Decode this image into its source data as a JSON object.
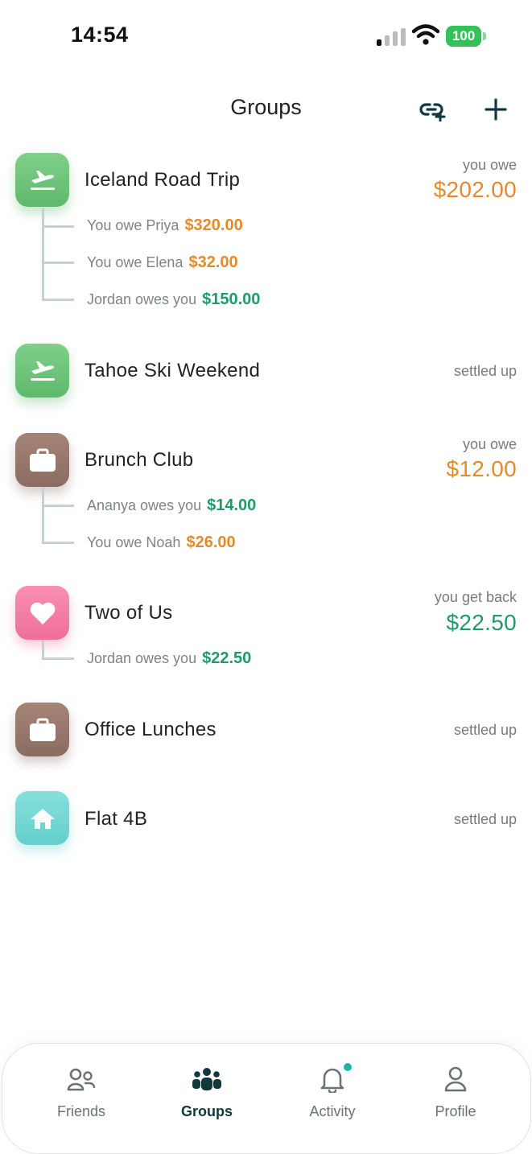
{
  "status_bar": {
    "time": "14:54",
    "battery": "100",
    "icons": [
      "signal-icon",
      "wifi-icon",
      "battery-icon"
    ]
  },
  "header": {
    "title": "Groups",
    "actions": [
      "link-add-icon",
      "plus-icon"
    ]
  },
  "groups": [
    {
      "name": "Iceland Road Trip",
      "icon": "airplane-icon",
      "color": "#6cc47a",
      "status_label": "you owe",
      "amount": "$202.00",
      "amount_color": "#e48a2a",
      "details": [
        {
          "text": "You owe Priya",
          "amount": "$320.00",
          "amount_color": "#e48a2a"
        },
        {
          "text": "You owe Elena",
          "amount": "$32.00",
          "amount_color": "#e48a2a"
        },
        {
          "text": "Jordan owes you",
          "amount": "$150.00",
          "amount_color": "#1f9a69"
        }
      ]
    },
    {
      "name": "Tahoe Ski Weekend",
      "icon": "airplane-icon",
      "color": "#6cc47a",
      "status_label": "settled up"
    },
    {
      "name": "Brunch Club",
      "icon": "briefcase-icon",
      "color": "#937367",
      "status_label": "you owe",
      "amount": "$12.00",
      "amount_color": "#e48a2a",
      "details": [
        {
          "text": "Ananya owes you",
          "amount": "$14.00",
          "amount_color": "#1f9a69"
        },
        {
          "text": "You owe Noah",
          "amount": "$26.00",
          "amount_color": "#e48a2a"
        }
      ]
    },
    {
      "name": "Two of Us",
      "icon": "heart-icon",
      "color": "#f37ca3",
      "status_label": "you get back",
      "amount": "$22.50",
      "amount_color": "#1f9a69",
      "details": [
        {
          "text": "Jordan owes you",
          "amount": "$22.50",
          "amount_color": "#1f9a69"
        }
      ]
    },
    {
      "name": "Office Lunches",
      "icon": "briefcase-icon",
      "color": "#937367",
      "status_label": "settled up"
    },
    {
      "name": "Flat 4B",
      "icon": "home-icon",
      "color": "#73d7d3",
      "status_label": "settled up"
    }
  ],
  "tabbar": {
    "tabs": [
      {
        "label": "Friends",
        "icon": "friends-icon",
        "active": false
      },
      {
        "label": "Groups",
        "icon": "groups-icon",
        "active": true
      },
      {
        "label": "Activity",
        "icon": "bell-icon",
        "active": false,
        "badge_dot": true
      },
      {
        "label": "Profile",
        "icon": "person-icon",
        "active": false
      }
    ]
  }
}
